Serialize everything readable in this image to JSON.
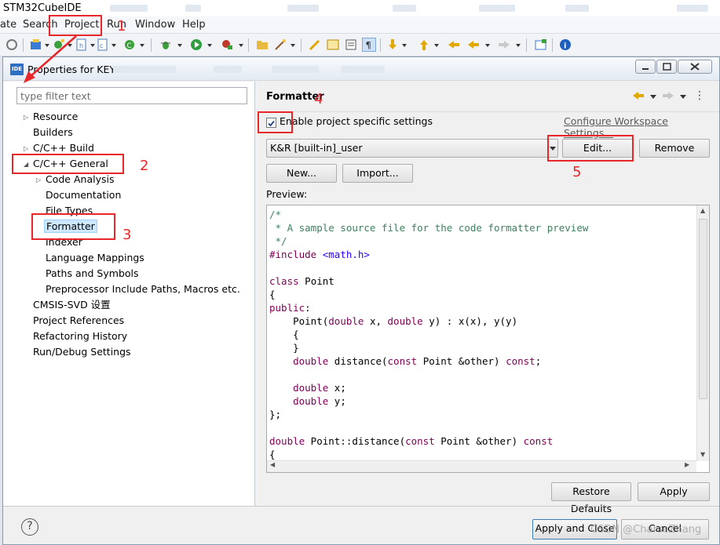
{
  "app": {
    "title": "STM32CubeIDE",
    "menu": [
      "ate",
      "Search",
      "Project",
      "Run",
      "Window",
      "Help"
    ]
  },
  "dialog": {
    "title": "Properties for KEY",
    "icon_label": "IDE",
    "filter_placeholder": "type filter text",
    "tree": [
      "Resource",
      "Builders",
      "C/C++ Build",
      "C/C++ General",
      "Code Analysis",
      "Documentation",
      "File Types",
      "Formatter",
      "Indexer",
      "Language Mappings",
      "Paths and Symbols",
      "Preprocessor Include Paths, Macros etc.",
      "CMSIS-SVD 设置",
      "Project References",
      "Refactoring History",
      "Run/Debug Settings"
    ],
    "page_title": "Formatter",
    "enable_label": "Enable project specific settings",
    "enable_checked": true,
    "configure_link": "Configure Workspace Settings...",
    "profile": "K&R [built-in]_user",
    "buttons": {
      "edit": "Edit...",
      "remove": "Remove",
      "new": "New...",
      "import": "Import...",
      "restore_defaults": "Restore Defaults",
      "apply": "Apply",
      "apply_and_close": "Apply and Close",
      "cancel": "Cancel"
    },
    "preview_label": "Preview:"
  },
  "annotations": [
    "1",
    "2",
    "3",
    "4",
    "5"
  ],
  "watermark": "CSDN @CharseZhang",
  "icons": [
    "ide-icon",
    "minimize-icon",
    "maximize-icon",
    "close-icon",
    "back-arrow-icon",
    "forward-arrow-icon",
    "view-menu-icon",
    "help-icon"
  ],
  "colors": {
    "annotation": "#e8272b",
    "selection": "#cde8ff",
    "comment": "#3f7f5f",
    "keyword": "#7f0055",
    "string": "#2a00ff"
  }
}
